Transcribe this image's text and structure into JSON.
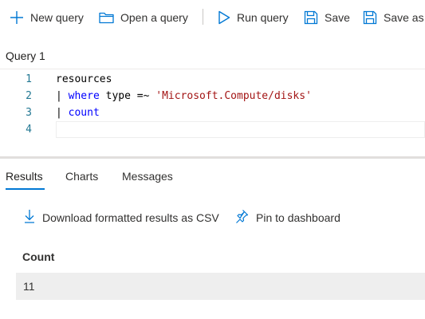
{
  "toolbar": {
    "new_query": "New query",
    "open_query": "Open a query",
    "run_query": "Run query",
    "save": "Save",
    "save_as": "Save as"
  },
  "editor": {
    "tab_label": "Query 1",
    "lines": [
      {
        "number": "1",
        "text": "resources"
      },
      {
        "number": "2",
        "pipe": "| ",
        "keyword": "where",
        "text": " type =~ ",
        "string": "'Microsoft.Compute/disks'"
      },
      {
        "number": "3",
        "pipe": "| ",
        "keyword": "count"
      },
      {
        "number": "4"
      }
    ]
  },
  "results": {
    "tabs": [
      "Results",
      "Charts",
      "Messages"
    ],
    "active_tab": "Results",
    "actions": {
      "download": "Download formatted results as CSV",
      "pin": "Pin to dashboard"
    },
    "table": {
      "columns": [
        "Count"
      ],
      "rows": [
        [
          "11"
        ]
      ]
    }
  },
  "colors": {
    "accent": "#0078d4",
    "keyword": "#0000ff",
    "string": "#a31515",
    "line_number": "#237893"
  }
}
